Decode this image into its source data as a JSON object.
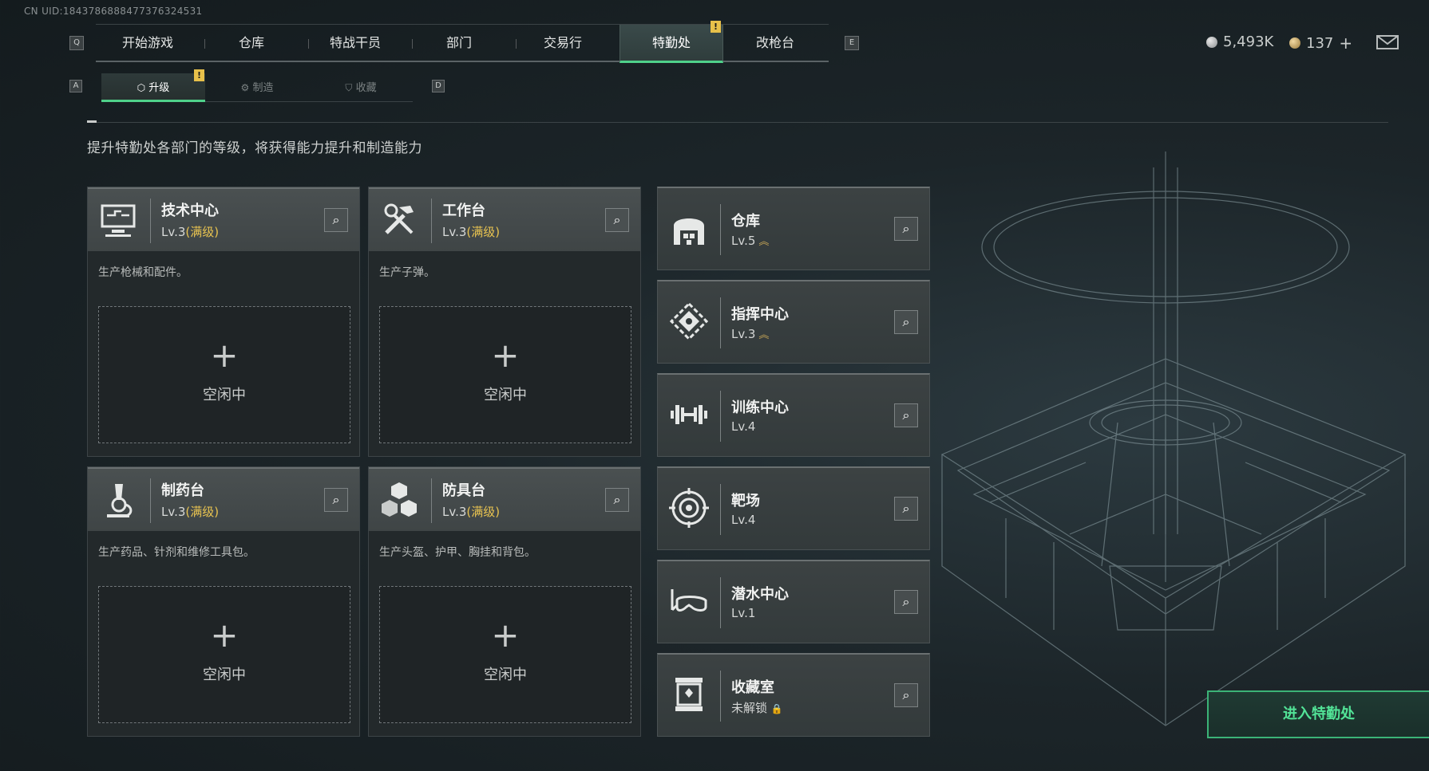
{
  "uid_text": "CN UID:1843786888477376324531",
  "main_nav": {
    "left_key": "Q",
    "right_key": "E",
    "tabs": [
      {
        "label": "开始游戏"
      },
      {
        "label": "仓库"
      },
      {
        "label": "特战干员"
      },
      {
        "label": "部门"
      },
      {
        "label": "交易行"
      },
      {
        "label": "特勤处",
        "active": true,
        "badge": "!"
      },
      {
        "label": "改枪台"
      }
    ]
  },
  "currency": {
    "silver": "5,493K",
    "gold": "137",
    "gold_add": "+"
  },
  "sub_nav": {
    "left_key": "A",
    "right_key": "D",
    "tabs": [
      {
        "label": "升级",
        "active": true,
        "badge": "!"
      },
      {
        "label": "制造"
      },
      {
        "label": "收藏"
      }
    ]
  },
  "description": "提升特勤处各部门的等级，将获得能力提升和制造能力",
  "production_cards": [
    {
      "title": "技术中心",
      "level": "Lv.3",
      "level_note": "(满级)",
      "desc": "生产枪械和配件。",
      "icon": "computer-icon",
      "slot_plus": "+",
      "slot_status": "空闲中"
    },
    {
      "title": "工作台",
      "level": "Lv.3",
      "level_note": "(满级)",
      "desc": "生产子弹。",
      "icon": "tools-icon",
      "slot_plus": "+",
      "slot_status": "空闲中"
    },
    {
      "title": "制药台",
      "level": "Lv.3",
      "level_note": "(满级)",
      "desc": "生产药品、针剂和维修工具包。",
      "icon": "microscope-icon",
      "slot_plus": "+",
      "slot_status": "空闲中"
    },
    {
      "title": "防具台",
      "level": "Lv.3",
      "level_note": "(满级)",
      "desc": "生产头盔、护甲、胸挂和背包。",
      "icon": "cubes-icon",
      "slot_plus": "+",
      "slot_status": "空闲中"
    }
  ],
  "facilities": [
    {
      "title": "仓库",
      "level": "Lv.5",
      "upgradable": true,
      "icon": "warehouse-icon"
    },
    {
      "title": "指挥中心",
      "level": "Lv.3",
      "upgradable": true,
      "icon": "command-icon"
    },
    {
      "title": "训练中心",
      "level": "Lv.4",
      "upgradable": false,
      "icon": "dumbbell-icon"
    },
    {
      "title": "靶场",
      "level": "Lv.4",
      "upgradable": false,
      "icon": "target-icon"
    },
    {
      "title": "潜水中心",
      "level": "Lv.1",
      "upgradable": false,
      "icon": "diving-mask-icon"
    },
    {
      "title": "收藏室",
      "level": "未解锁",
      "locked": true,
      "icon": "display-case-icon"
    }
  ],
  "up_glyph": "︽",
  "lock_glyph": "🔒",
  "search_glyph": "⌕",
  "enter_button": "进入特勤处",
  "colors": {
    "accent_green": "#4fd18a",
    "max_level_gold": "#e8c350",
    "badge_yellow": "#e7c04a"
  }
}
